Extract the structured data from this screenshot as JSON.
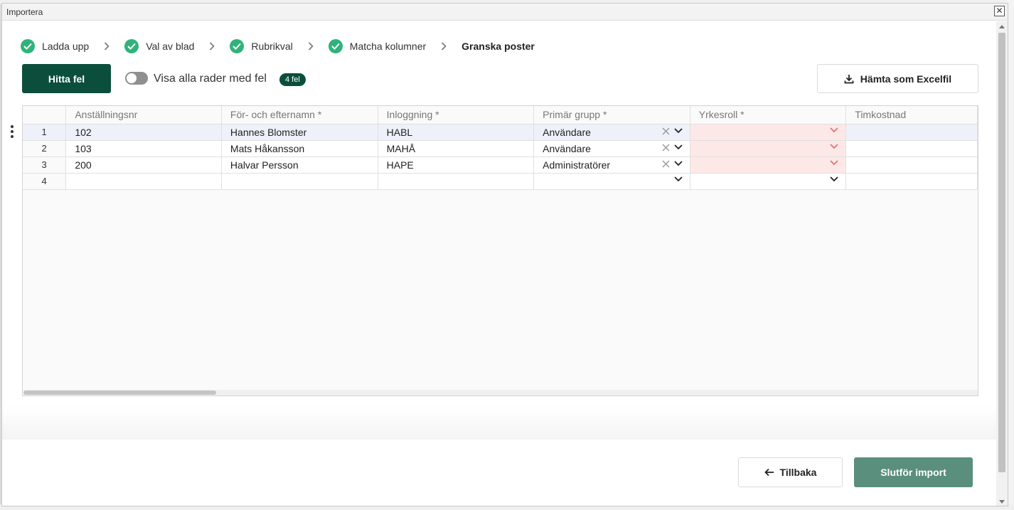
{
  "dialog": {
    "title": "Importera"
  },
  "steps": [
    {
      "label": "Ladda upp",
      "done": true
    },
    {
      "label": "Val av blad",
      "done": true
    },
    {
      "label": "Rubrikval",
      "done": true
    },
    {
      "label": "Matcha kolumner",
      "done": true
    },
    {
      "label": "Granska poster",
      "done": false
    }
  ],
  "toolbar": {
    "find_errors_label": "Hitta fel",
    "toggle_label": "Visa alla rader med fel",
    "error_badge": "4 fel",
    "export_label": "Hämta som Excelfil"
  },
  "grid": {
    "columns": [
      "Anställningsnr",
      "För- och efternamn *",
      "Inloggning *",
      "Primär grupp *",
      "Yrkesroll *",
      "Timkostnad"
    ],
    "rows": [
      {
        "num": "1",
        "anstnr": "102",
        "name": "Hannes Blomster",
        "login": "HABL",
        "group": "Användare",
        "role": "",
        "cost": ""
      },
      {
        "num": "2",
        "anstnr": "103",
        "name": "Mats Håkansson",
        "login": "MAHÅ",
        "group": "Användare",
        "role": "",
        "cost": ""
      },
      {
        "num": "3",
        "anstnr": "200",
        "name": "Halvar Persson",
        "login": "HAPE",
        "group": "Administratörer",
        "role": "",
        "cost": ""
      },
      {
        "num": "4",
        "anstnr": "",
        "name": "",
        "login": "",
        "group": "",
        "role": "",
        "cost": ""
      }
    ]
  },
  "footer": {
    "back_label": "Tillbaka",
    "finish_label": "Slutför import"
  },
  "colors": {
    "success": "#2fb37a",
    "primary_dark": "#0c4e3c",
    "primary_disabled": "#5a8e7d",
    "error_cell": "#fde8e8",
    "error_chevron": "#e57373"
  }
}
